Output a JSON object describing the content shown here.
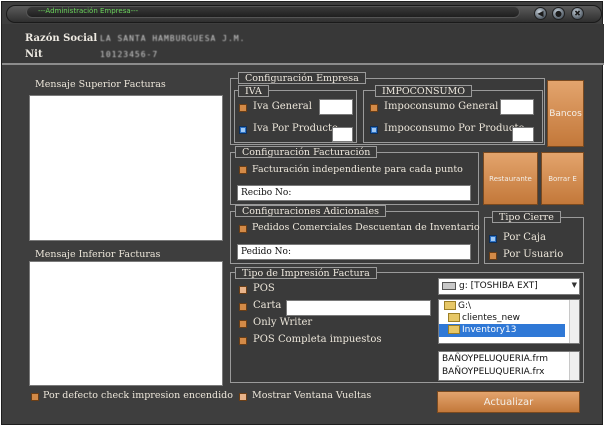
{
  "window": {
    "title": "---Administración Empresa---",
    "buttons": [
      "◀",
      "●",
      "✖"
    ]
  },
  "header": {
    "razon_label": "Razón Social",
    "razon_value": "LA SANTA HAMBURGUESA J.M.",
    "nit_label": "Nit",
    "nit_value": "10123456-7"
  },
  "left": {
    "superior_title": "Mensaje Superior Facturas",
    "inferior_title": "Mensaje Inferior Facturas",
    "check_label": "Por defecto check impresion encendido"
  },
  "empresa": {
    "title": "Configuración Empresa",
    "iva_title": "IVA",
    "iva_general": "Iva General",
    "iva_producto": "Iva Por Producto",
    "impo_title": "IMPOCONSUMO",
    "impo_general": "Impoconsumo General",
    "impo_producto": "Impoconsumo Por Producto",
    "bancos": "Bancos"
  },
  "facturacion": {
    "title": "Configuración Facturación",
    "independiente": "Facturación independiente para cada punto",
    "recibo_value": "Recibo No:",
    "restaurante": "Restaurante",
    "borrar": "Borrar E"
  },
  "adicionales": {
    "title": "Configuraciones Adicionales",
    "pedidos": "Pedidos Comerciales Descuentan de Inventario",
    "pedido_value": "Pedido No:"
  },
  "cierre": {
    "title": "Tipo Cierre",
    "por_caja": "Por Caja",
    "por_usuario": "Por Usuario"
  },
  "impresion": {
    "title": "Tipo de Impresión Factura",
    "pos": "POS",
    "carta": "Carta",
    "only_writer": "Only Writer",
    "pos_completa": "POS Completa impuestos",
    "drive": "g: [TOSHIBA EXT]",
    "folders": [
      "G:\\",
      "clientes_new",
      "Inventory13"
    ],
    "files": [
      "BAÑOYPELUQUERIA.frm",
      "BAÑOYPELUQUERIA.frx"
    ]
  },
  "footer": {
    "vueltas": "Mostrar Ventana Vueltas",
    "actualizar": "Actualizar"
  }
}
